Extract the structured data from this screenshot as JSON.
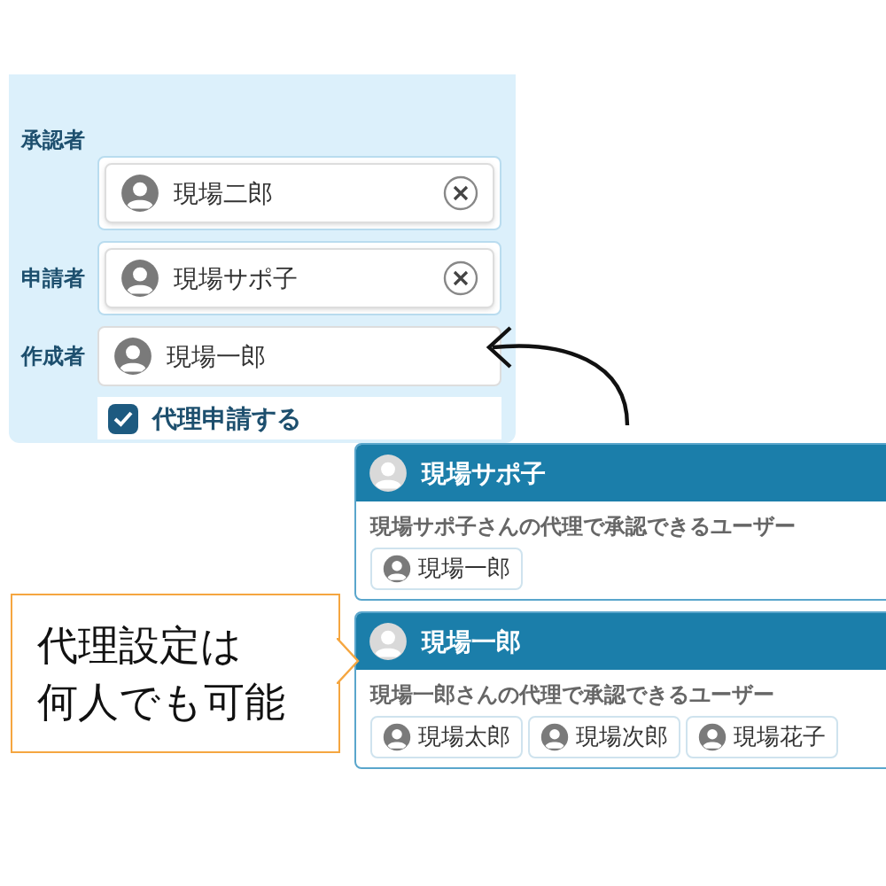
{
  "form": {
    "fields": [
      {
        "label": "承認者",
        "users": [
          {
            "name": "現場二郎",
            "removable": true
          }
        ]
      },
      {
        "label": "申請者",
        "users": [
          {
            "name": "現場サポ子",
            "removable": true
          }
        ]
      },
      {
        "label": "作成者",
        "users": [
          {
            "name": "現場一郎",
            "removable": false
          }
        ]
      }
    ],
    "proxy_checkbox": {
      "label": "代理申請する",
      "checked": true
    }
  },
  "delegate_cards": [
    {
      "name": "現場サポ子",
      "description": "現場サポ子さんの代理で承認できるユーザー",
      "users": [
        "現場一郎"
      ]
    },
    {
      "name": "現場一郎",
      "description": "現場一郎さんの代理で承認できるユーザー",
      "users": [
        "現場太郎",
        "現場次郎",
        "現場花子"
      ]
    }
  ],
  "callout": {
    "lines": [
      "代理設定は",
      "何人でも可能"
    ]
  }
}
